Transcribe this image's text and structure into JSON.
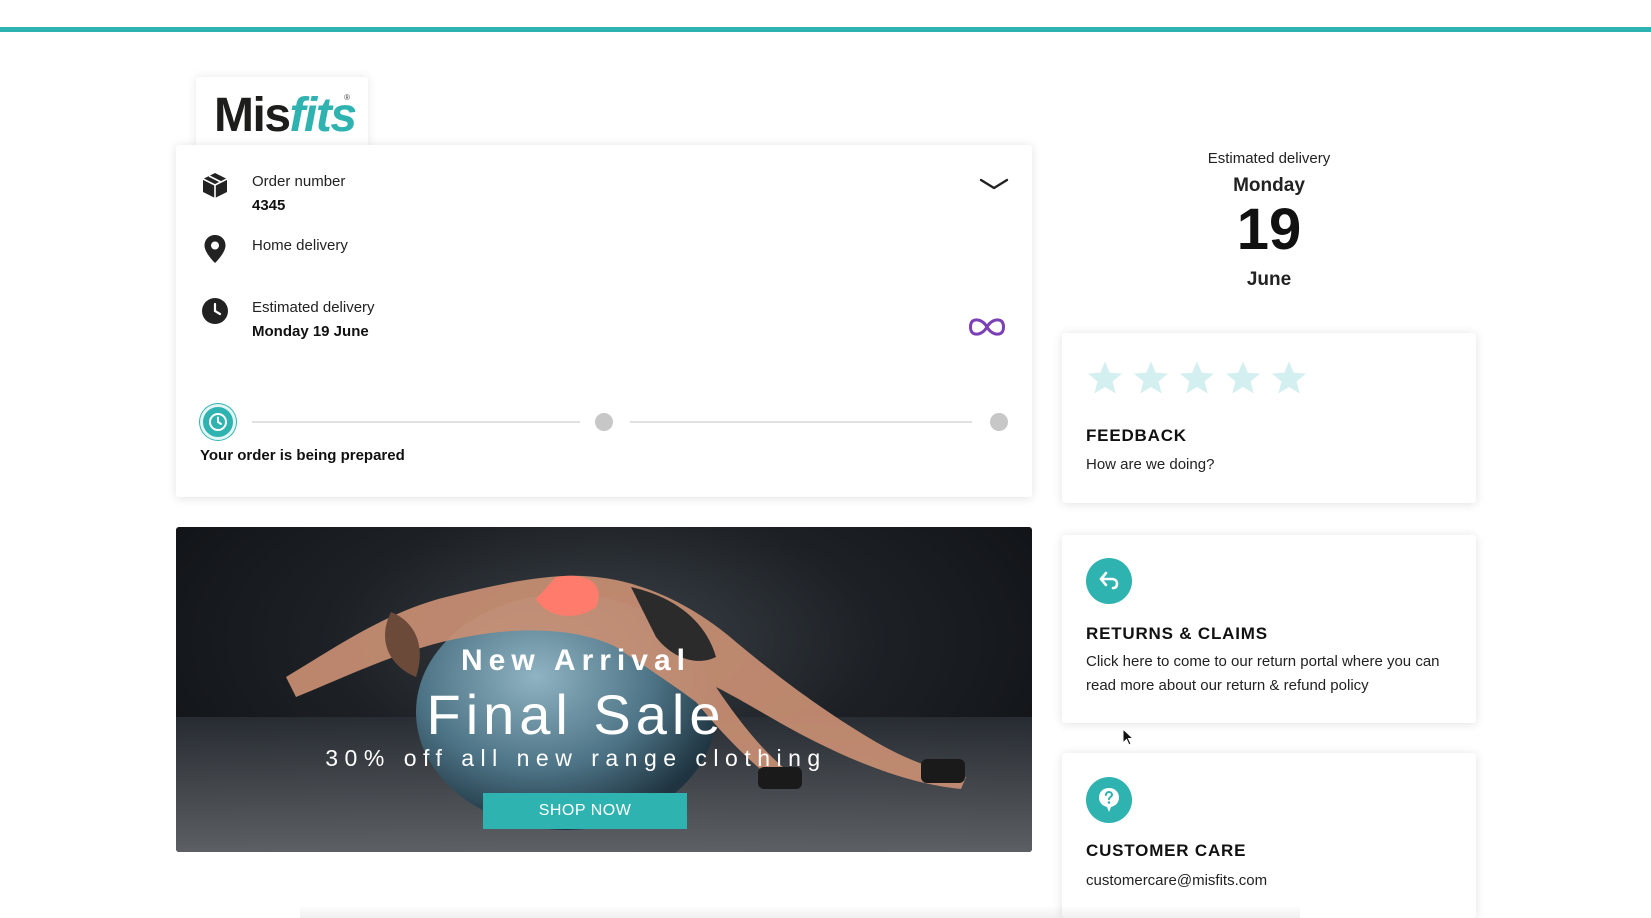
{
  "brand": {
    "name_part1": "Mis",
    "name_part2": "fits",
    "registered": "®",
    "accent": "#2fb3b0"
  },
  "order": {
    "number_label": "Order number",
    "number_value": "4345",
    "delivery_type": "Home delivery",
    "estimated_label": "Estimated delivery",
    "estimated_value": "Monday 19 June",
    "status": "Your order is being prepared",
    "progress_step": 1,
    "progress_total": 3
  },
  "icons": {
    "package": "package-icon",
    "location": "location-pin-icon",
    "clock": "clock-icon",
    "chevron": "chevron-down-icon",
    "infinity": "infinity-icon",
    "returns": "return-arrow-icon",
    "care": "question-bubble-icon"
  },
  "banner": {
    "line1": "New Arrival",
    "line2": "Final Sale",
    "line3": "30% off all new range clothing",
    "button": "SHOP NOW"
  },
  "estimate": {
    "label": "Estimated delivery",
    "day": "Monday",
    "date": "19",
    "month": "June"
  },
  "feedback": {
    "title": "FEEDBACK",
    "text": "How are we doing?",
    "rating": 0,
    "max": 5,
    "star_color": "#d4eff0"
  },
  "returns": {
    "title": "RETURNS & CLAIMS",
    "text": "Click here to come to our return portal where you can read more about our return & refund policy"
  },
  "care": {
    "title": "CUSTOMER CARE",
    "email": "customercare@misfits.com"
  }
}
